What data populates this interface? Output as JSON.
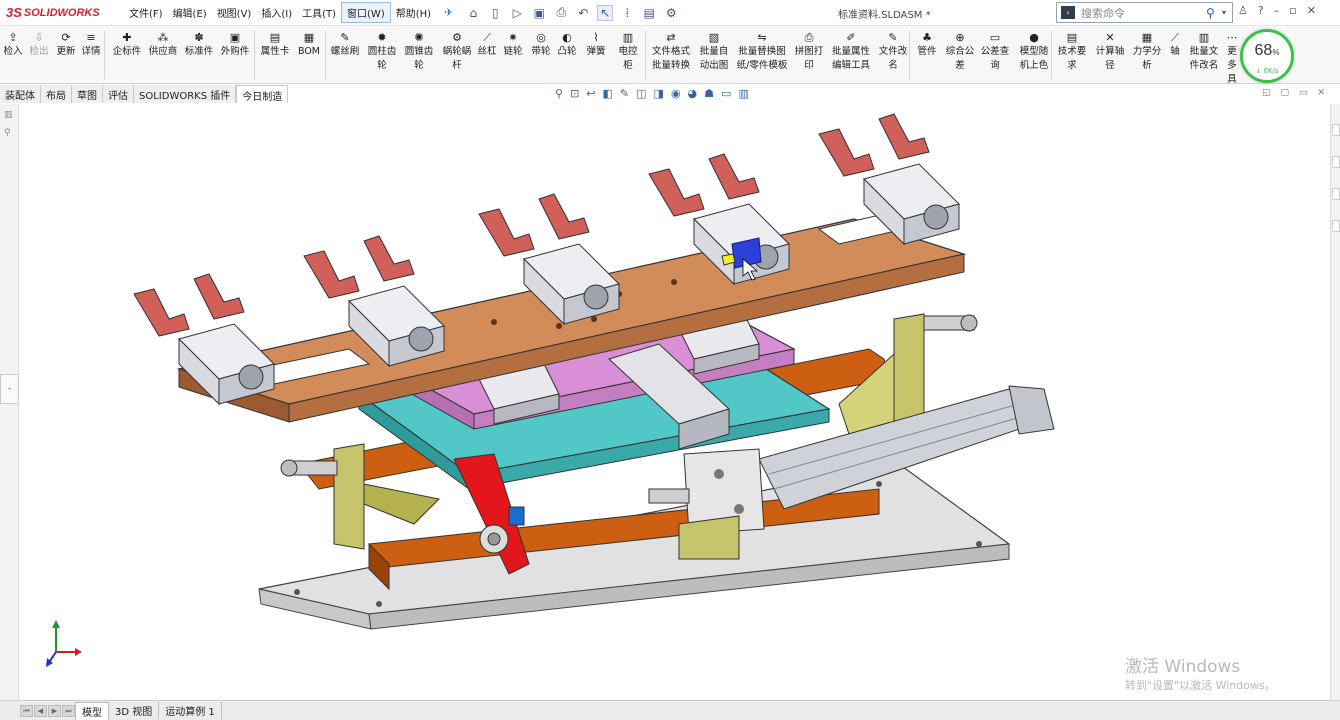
{
  "app": {
    "logo_text": "SOLIDWORKS",
    "logo_mark": "3S",
    "document_title": "标准资料.SLDASM *"
  },
  "menu": [
    "文件(F)",
    "编辑(E)",
    "视图(V)",
    "插入(I)",
    "工具(T)",
    "窗口(W)",
    "帮助(H)"
  ],
  "search": {
    "placeholder": "搜索命令"
  },
  "ribbon": {
    "buttons": [
      {
        "label": "检入",
        "icon": "checkin-icon",
        "glyph": "⇪",
        "disabled": false
      },
      {
        "label": "检出",
        "icon": "checkout-icon",
        "glyph": "⇩",
        "disabled": true
      },
      {
        "label": "更新",
        "icon": "update-icon",
        "glyph": "⟳",
        "disabled": false
      },
      {
        "label": "详情",
        "icon": "details-icon",
        "glyph": "≡",
        "disabled": false
      },
      {
        "label": "企标件",
        "icon": "enterprise-part-icon",
        "glyph": "✚",
        "disabled": false
      },
      {
        "label": "供应商",
        "icon": "supplier-icon",
        "glyph": "⁂",
        "disabled": false
      },
      {
        "label": "标准件",
        "icon": "standard-part-icon",
        "glyph": "✽",
        "disabled": false
      },
      {
        "label": "外购件",
        "icon": "purchased-part-icon",
        "glyph": "▣",
        "disabled": false
      },
      {
        "label": "属性卡",
        "icon": "property-card-icon",
        "glyph": "▤",
        "disabled": false
      },
      {
        "label": "BOM",
        "icon": "bom-icon",
        "glyph": "▦",
        "disabled": false
      },
      {
        "label": "螺丝刷",
        "icon": "screw-brush-icon",
        "glyph": "✎",
        "disabled": false
      },
      {
        "label": "圆柱齿\n轮",
        "icon": "spur-gear-icon",
        "glyph": "✹",
        "disabled": false
      },
      {
        "label": "圆锥齿\n轮",
        "icon": "bevel-gear-icon",
        "glyph": "✺",
        "disabled": false
      },
      {
        "label": "蜗轮蜗\n杆",
        "icon": "worm-gear-icon",
        "glyph": "⚙",
        "disabled": false
      },
      {
        "label": "丝杠",
        "icon": "lead-screw-icon",
        "glyph": "⟋",
        "disabled": false
      },
      {
        "label": "链轮",
        "icon": "sprocket-icon",
        "glyph": "✷",
        "disabled": false
      },
      {
        "label": "带轮",
        "icon": "pulley-icon",
        "glyph": "◎",
        "disabled": false
      },
      {
        "label": "凸轮",
        "icon": "cam-icon",
        "glyph": "◐",
        "disabled": false
      },
      {
        "label": "弹簧",
        "icon": "spring-icon",
        "glyph": "⌇",
        "disabled": false
      },
      {
        "label": "电控柜",
        "icon": "control-cabinet-icon",
        "glyph": "▥",
        "disabled": false
      },
      {
        "label": "文件格式\n批量转换",
        "icon": "batch-convert-icon",
        "glyph": "⇄",
        "disabled": false
      },
      {
        "label": "批量自\n动出图",
        "icon": "auto-drawing-icon",
        "glyph": "▧",
        "disabled": false
      },
      {
        "label": "批量替换图\n纸/零件模板",
        "icon": "replace-template-icon",
        "glyph": "⇋",
        "disabled": false
      },
      {
        "label": "拼图打\n印",
        "icon": "print-icon",
        "glyph": "⎙",
        "disabled": false
      },
      {
        "label": "批量属性\n编辑工具",
        "icon": "batch-property-icon",
        "glyph": "✐",
        "disabled": false
      },
      {
        "label": "文件改\n名",
        "icon": "rename-icon",
        "glyph": "✎",
        "disabled": false
      },
      {
        "label": "管件",
        "icon": "pipe-icon",
        "glyph": "♣",
        "disabled": false
      },
      {
        "label": "综合公\n差",
        "icon": "tolerance-icon",
        "glyph": "⊕",
        "disabled": false
      },
      {
        "label": "公差查\n询",
        "icon": "tolerance-query-icon",
        "glyph": "▭",
        "disabled": false
      },
      {
        "label": "模型随\n机上色",
        "icon": "random-color-icon",
        "glyph": "●",
        "disabled": false
      },
      {
        "label": "技术要\n求",
        "icon": "tech-requirements-icon",
        "glyph": "▤",
        "disabled": false
      },
      {
        "label": "计算轴\n径",
        "icon": "shaft-diameter-icon",
        "glyph": "✕",
        "disabled": false
      },
      {
        "label": "力学分\n析",
        "icon": "mechanics-icon",
        "glyph": "▦",
        "disabled": false
      },
      {
        "label": "轴",
        "icon": "shaft-icon",
        "glyph": "⟋",
        "disabled": false
      },
      {
        "label": "批量文\n件改名",
        "icon": "batch-rename-icon",
        "glyph": "▥",
        "disabled": false
      },
      {
        "label": "更多\n具",
        "icon": "more-tools-icon",
        "glyph": "⋯",
        "disabled": false
      }
    ]
  },
  "performance": {
    "percent": "68",
    "percent_unit": "%",
    "rate": "↓ 0K/s",
    "accent": "#3cc04a"
  },
  "command_tabs": [
    "装配体",
    "布局",
    "草图",
    "评估",
    "SOLIDWORKS 插件",
    "今日制造"
  ],
  "active_command_tab": "今日制造",
  "bottom_tabs": [
    "模型",
    "3D 视图",
    "运动算例 1"
  ],
  "active_bottom_tab": "模型",
  "watermark": {
    "line1": "激活 Windows",
    "line2": "转到\"设置\"以激活 Windows。"
  },
  "colors": {
    "plate": "#d28c5a",
    "magenta_plate": "#d98fd6",
    "cyan_plate": "#52c7c7",
    "base_plate": "#e1e1e1",
    "rail": "#cc5f12",
    "gripper": "#d1605a",
    "olive_bracket": "#c7c36a",
    "red_block": "#e2161b",
    "selected_blue": "#2c3fd8"
  }
}
